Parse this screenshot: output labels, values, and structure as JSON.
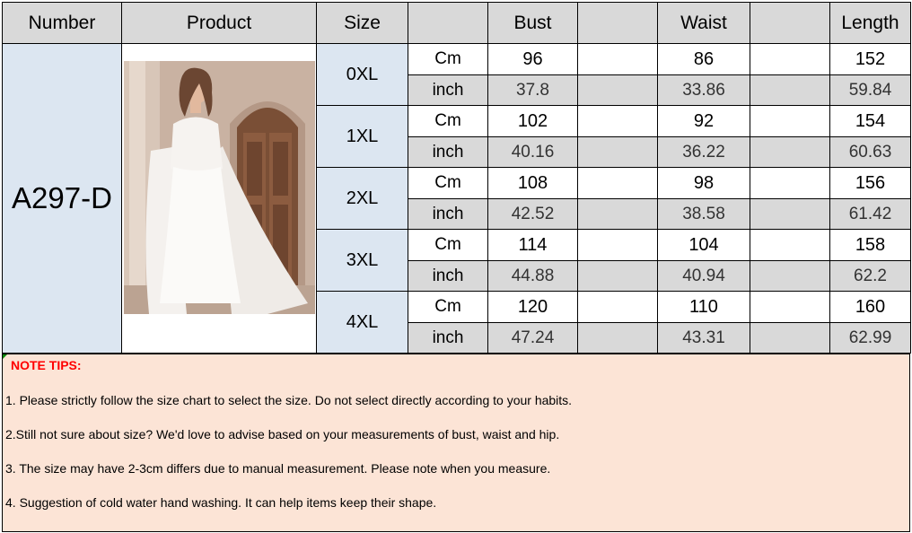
{
  "header": {
    "number": "Number",
    "product": "Product",
    "size": "Size",
    "bust": "Bust",
    "waist": "Waist",
    "length": "Length"
  },
  "item_number": "A297-D",
  "rows": [
    {
      "size": "0XL",
      "cm_label": "Cm",
      "inch_label": "inch",
      "bust_cm": "96",
      "waist_cm": "86",
      "length_cm": "152",
      "bust_in": "37.8",
      "waist_in": "33.86",
      "length_in": "59.84"
    },
    {
      "size": "1XL",
      "cm_label": "Cm",
      "inch_label": "inch",
      "bust_cm": "102",
      "waist_cm": "92",
      "length_cm": "154",
      "bust_in": "40.16",
      "waist_in": "36.22",
      "length_in": "60.63"
    },
    {
      "size": "2XL",
      "cm_label": "Cm",
      "inch_label": "inch",
      "bust_cm": "108",
      "waist_cm": "98",
      "length_cm": "156",
      "bust_in": "42.52",
      "waist_in": "38.58",
      "length_in": "61.42"
    },
    {
      "size": "3XL",
      "cm_label": "Cm",
      "inch_label": "inch",
      "bust_cm": "114",
      "waist_cm": "104",
      "length_cm": "158",
      "bust_in": "44.88",
      "waist_in": "40.94",
      "length_in": "62.2"
    },
    {
      "size": "4XL",
      "cm_label": "Cm",
      "inch_label": "inch",
      "bust_cm": "120",
      "waist_cm": "110",
      "length_cm": "160",
      "bust_in": "47.24",
      "waist_in": "43.31",
      "length_in": "62.99"
    }
  ],
  "notes": {
    "title": "NOTE TIPS:",
    "tips": [
      " 1. Please strictly follow the size chart to select the size. Do not select directly according to your habits.",
      "2.Still not sure about size? We'd love to advise based on your measurements of bust, waist and hip.",
      "3. The size may have 2-3cm differs due to manual measurement. Please note when you measure.",
      "4. Suggestion of cold water hand washing. It can help items keep their shape."
    ]
  },
  "colors": {
    "header_bg": "#d9d9d9",
    "number_bg": "#dce6f1",
    "notes_bg": "#fce4d6",
    "note_title": "#ff0000"
  },
  "icons": {
    "product_photo": "white-cape-gown-photo-icon"
  }
}
